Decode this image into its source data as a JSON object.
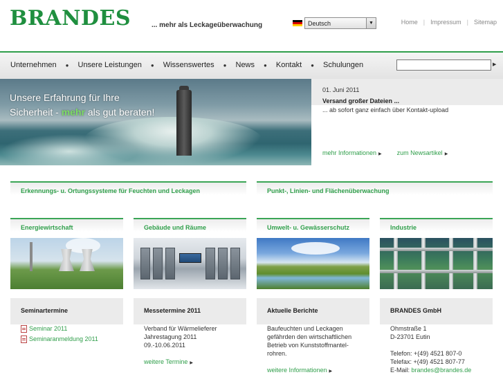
{
  "header": {
    "logo": "BRANDES",
    "tagline": "... mehr als Leckageüberwachung",
    "language": "Deutsch",
    "toplinks": [
      "Home",
      "Impressum",
      "Sitemap"
    ]
  },
  "nav": {
    "items": [
      "Unternehmen",
      "Unsere Leistungen",
      "Wissenswertes",
      "News",
      "Kontakt",
      "Schulungen"
    ],
    "search_value": ""
  },
  "hero": {
    "line1": "Unsere Erfahrung für Ihre",
    "line2_pre": "Sicherheit - ",
    "line2_highlight": "mehr",
    "line2_post": " als gut beraten!"
  },
  "news": {
    "date": "01. Juni 2011",
    "title": "Versand großer Dateien ...",
    "text": "... ab sofort ganz einfach über Kontakt-upload",
    "link1": "mehr Informationen",
    "link2": "zum Newsartikel"
  },
  "sections": {
    "left_title": "Erkennungs- u. Ortungssysteme für Feuchten und Leckagen",
    "right_title": "Punkt-, Linien- und Flächenüberwachung"
  },
  "columns": [
    {
      "title": "Energiewirtschaft"
    },
    {
      "title": "Gebäude und Räume"
    },
    {
      "title": "Umwelt- u. Gewässerschutz"
    },
    {
      "title": "Industrie"
    }
  ],
  "boxes": {
    "seminar": {
      "title": "Seminartermine",
      "link1": "Seminar 2011",
      "link2": "Seminaranmeldung 2011"
    },
    "messe": {
      "title": "Messetermine 2011",
      "line1": "Verband für Wärmelieferer",
      "line2": "Jahrestagung 2011",
      "line3": "09.-10.06.2011",
      "link": "weitere Termine"
    },
    "berichte": {
      "title": "Aktuelle Berichte",
      "line1": "Baufeuchten und Leckagen",
      "line2": "gefährden den wirtschaftlichen",
      "line3": "Betrieb von Kunststoffmantel-",
      "line4": "rohren.",
      "link": "weitere Informationen"
    },
    "contact": {
      "title": "BRANDES GmbH",
      "street": "Ohmstraße 1",
      "city": "D-23701 Eutin",
      "phone": "Telefon: +(49) 4521 807-0",
      "fax": "Telefax: +(49) 4521 807-77",
      "email_label": "E-Mail: ",
      "email": "brandes@brandes.de"
    }
  },
  "colors": {
    "brand_green": "#1f8f3f",
    "accent_green": "#2f9e4a",
    "nav_bg": "#e3e3e3"
  }
}
